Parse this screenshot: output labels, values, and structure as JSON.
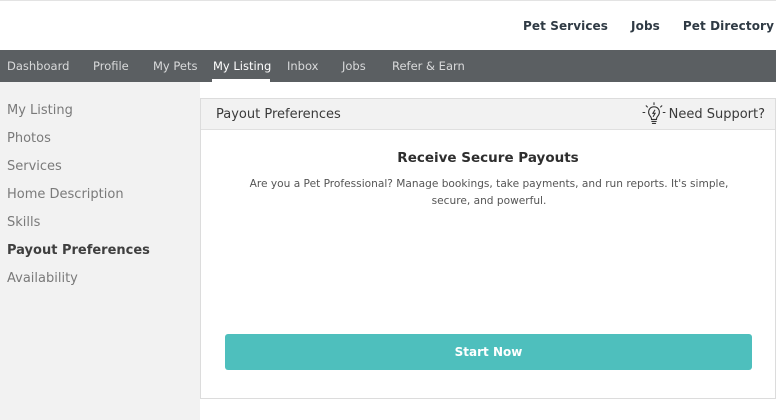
{
  "topnav": {
    "links": [
      "Pet Services",
      "Jobs",
      "Pet Directory"
    ]
  },
  "mainnav": {
    "items": [
      "Dashboard",
      "Profile",
      "My Pets",
      "My Listing",
      "Inbox",
      "Jobs",
      "Refer & Earn"
    ],
    "active": "My Listing"
  },
  "sidebar": {
    "items": [
      "My Listing",
      "Photos",
      "Services",
      "Home Description",
      "Skills",
      "Payout Preferences",
      "Availability"
    ],
    "active": "Payout Preferences"
  },
  "card": {
    "title": "Payout Preferences",
    "support_label": "Need Support?",
    "support_icon": "lightbulb-icon",
    "heading": "Receive Secure Payouts",
    "description": "Are you a Pet Professional? Manage bookings, take payments, and run reports. It's simple, secure, and powerful.",
    "button_label": "Start Now"
  },
  "colors": {
    "nav_bg": "#5b5f62",
    "sidebar_bg": "#f2f2f2",
    "accent": "#4ebfbd"
  }
}
